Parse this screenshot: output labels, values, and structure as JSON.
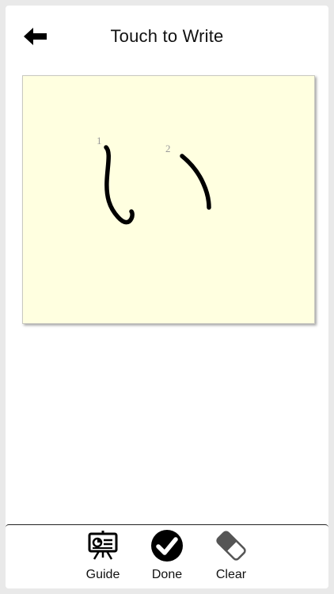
{
  "header": {
    "title": "Touch to Write",
    "back_icon": "arrow-left-icon"
  },
  "canvas": {
    "stroke_numbers": [
      "1",
      "2"
    ],
    "background_color": "#ffffe0"
  },
  "toolbar": {
    "guide_label": "Guide",
    "done_label": "Done",
    "clear_label": "Clear",
    "guide_icon": "presentation-board-icon",
    "done_icon": "checkmark-circle-icon",
    "clear_icon": "eraser-icon"
  }
}
